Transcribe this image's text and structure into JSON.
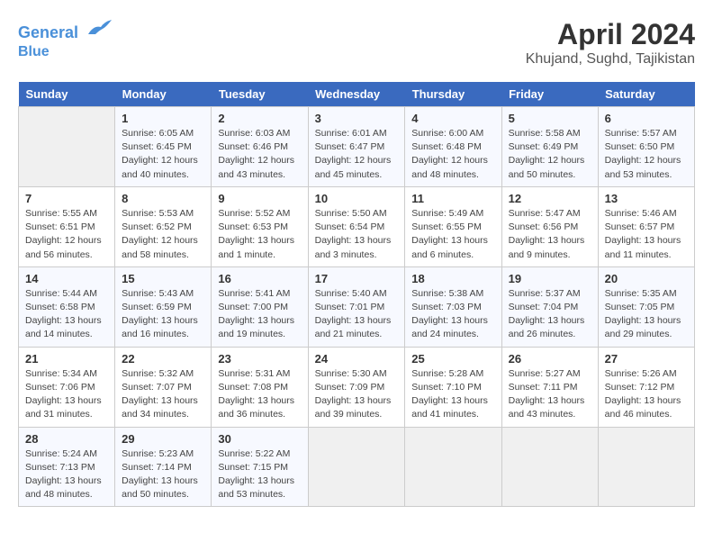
{
  "header": {
    "logo_line1": "General",
    "logo_line2": "Blue",
    "title": "April 2024",
    "subtitle": "Khujand, Sughd, Tajikistan"
  },
  "days_of_week": [
    "Sunday",
    "Monday",
    "Tuesday",
    "Wednesday",
    "Thursday",
    "Friday",
    "Saturday"
  ],
  "weeks": [
    [
      {
        "day": "",
        "info": ""
      },
      {
        "day": "1",
        "info": "Sunrise: 6:05 AM\nSunset: 6:45 PM\nDaylight: 12 hours\nand 40 minutes."
      },
      {
        "day": "2",
        "info": "Sunrise: 6:03 AM\nSunset: 6:46 PM\nDaylight: 12 hours\nand 43 minutes."
      },
      {
        "day": "3",
        "info": "Sunrise: 6:01 AM\nSunset: 6:47 PM\nDaylight: 12 hours\nand 45 minutes."
      },
      {
        "day": "4",
        "info": "Sunrise: 6:00 AM\nSunset: 6:48 PM\nDaylight: 12 hours\nand 48 minutes."
      },
      {
        "day": "5",
        "info": "Sunrise: 5:58 AM\nSunset: 6:49 PM\nDaylight: 12 hours\nand 50 minutes."
      },
      {
        "day": "6",
        "info": "Sunrise: 5:57 AM\nSunset: 6:50 PM\nDaylight: 12 hours\nand 53 minutes."
      }
    ],
    [
      {
        "day": "7",
        "info": "Sunrise: 5:55 AM\nSunset: 6:51 PM\nDaylight: 12 hours\nand 56 minutes."
      },
      {
        "day": "8",
        "info": "Sunrise: 5:53 AM\nSunset: 6:52 PM\nDaylight: 12 hours\nand 58 minutes."
      },
      {
        "day": "9",
        "info": "Sunrise: 5:52 AM\nSunset: 6:53 PM\nDaylight: 13 hours\nand 1 minute."
      },
      {
        "day": "10",
        "info": "Sunrise: 5:50 AM\nSunset: 6:54 PM\nDaylight: 13 hours\nand 3 minutes."
      },
      {
        "day": "11",
        "info": "Sunrise: 5:49 AM\nSunset: 6:55 PM\nDaylight: 13 hours\nand 6 minutes."
      },
      {
        "day": "12",
        "info": "Sunrise: 5:47 AM\nSunset: 6:56 PM\nDaylight: 13 hours\nand 9 minutes."
      },
      {
        "day": "13",
        "info": "Sunrise: 5:46 AM\nSunset: 6:57 PM\nDaylight: 13 hours\nand 11 minutes."
      }
    ],
    [
      {
        "day": "14",
        "info": "Sunrise: 5:44 AM\nSunset: 6:58 PM\nDaylight: 13 hours\nand 14 minutes."
      },
      {
        "day": "15",
        "info": "Sunrise: 5:43 AM\nSunset: 6:59 PM\nDaylight: 13 hours\nand 16 minutes."
      },
      {
        "day": "16",
        "info": "Sunrise: 5:41 AM\nSunset: 7:00 PM\nDaylight: 13 hours\nand 19 minutes."
      },
      {
        "day": "17",
        "info": "Sunrise: 5:40 AM\nSunset: 7:01 PM\nDaylight: 13 hours\nand 21 minutes."
      },
      {
        "day": "18",
        "info": "Sunrise: 5:38 AM\nSunset: 7:03 PM\nDaylight: 13 hours\nand 24 minutes."
      },
      {
        "day": "19",
        "info": "Sunrise: 5:37 AM\nSunset: 7:04 PM\nDaylight: 13 hours\nand 26 minutes."
      },
      {
        "day": "20",
        "info": "Sunrise: 5:35 AM\nSunset: 7:05 PM\nDaylight: 13 hours\nand 29 minutes."
      }
    ],
    [
      {
        "day": "21",
        "info": "Sunrise: 5:34 AM\nSunset: 7:06 PM\nDaylight: 13 hours\nand 31 minutes."
      },
      {
        "day": "22",
        "info": "Sunrise: 5:32 AM\nSunset: 7:07 PM\nDaylight: 13 hours\nand 34 minutes."
      },
      {
        "day": "23",
        "info": "Sunrise: 5:31 AM\nSunset: 7:08 PM\nDaylight: 13 hours\nand 36 minutes."
      },
      {
        "day": "24",
        "info": "Sunrise: 5:30 AM\nSunset: 7:09 PM\nDaylight: 13 hours\nand 39 minutes."
      },
      {
        "day": "25",
        "info": "Sunrise: 5:28 AM\nSunset: 7:10 PM\nDaylight: 13 hours\nand 41 minutes."
      },
      {
        "day": "26",
        "info": "Sunrise: 5:27 AM\nSunset: 7:11 PM\nDaylight: 13 hours\nand 43 minutes."
      },
      {
        "day": "27",
        "info": "Sunrise: 5:26 AM\nSunset: 7:12 PM\nDaylight: 13 hours\nand 46 minutes."
      }
    ],
    [
      {
        "day": "28",
        "info": "Sunrise: 5:24 AM\nSunset: 7:13 PM\nDaylight: 13 hours\nand 48 minutes."
      },
      {
        "day": "29",
        "info": "Sunrise: 5:23 AM\nSunset: 7:14 PM\nDaylight: 13 hours\nand 50 minutes."
      },
      {
        "day": "30",
        "info": "Sunrise: 5:22 AM\nSunset: 7:15 PM\nDaylight: 13 hours\nand 53 minutes."
      },
      {
        "day": "",
        "info": ""
      },
      {
        "day": "",
        "info": ""
      },
      {
        "day": "",
        "info": ""
      },
      {
        "day": "",
        "info": ""
      }
    ]
  ]
}
